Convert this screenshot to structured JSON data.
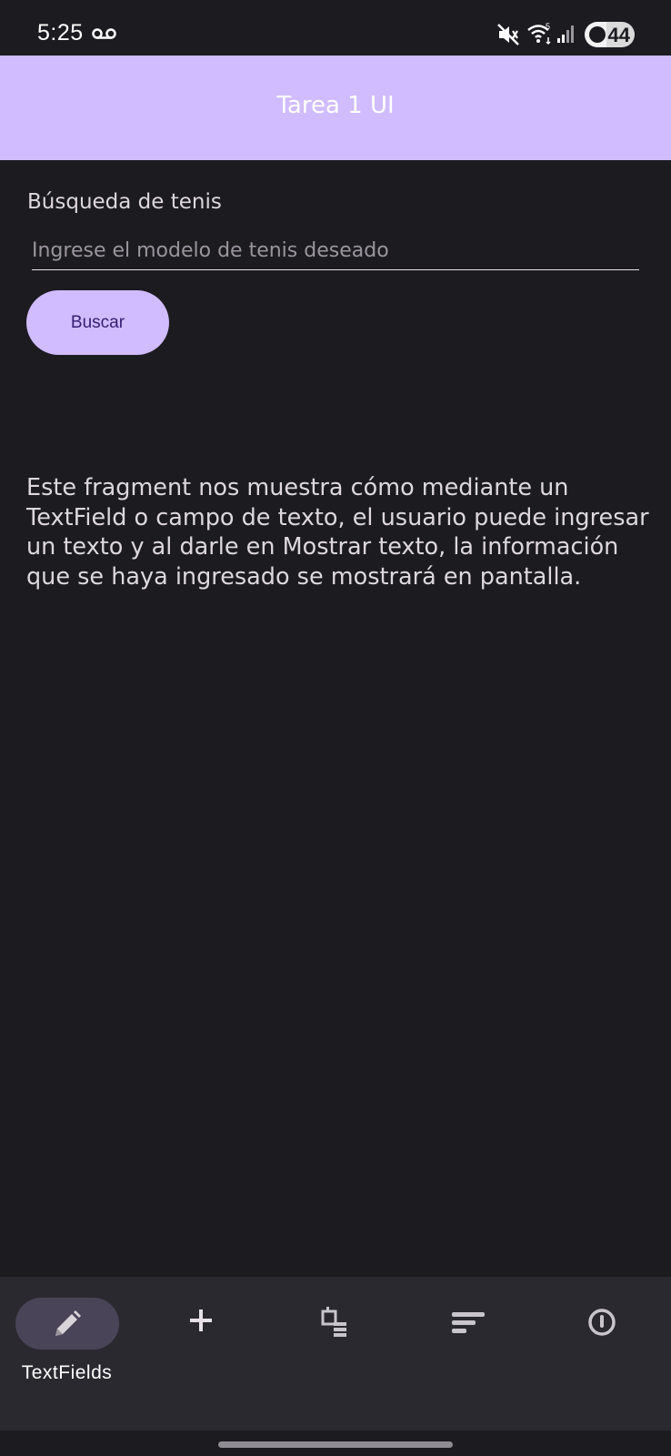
{
  "status_bar": {
    "time": "5:25",
    "battery_level": "44",
    "icons": [
      "voicemail-icon",
      "mute-icon",
      "wifi-icon",
      "signal-icon",
      "battery-icon"
    ]
  },
  "app_bar": {
    "title": "Tarea 1 UI",
    "color": "#d0bcff"
  },
  "form": {
    "section_label": "Búsqueda de tenis",
    "search_input": {
      "placeholder": "Ingrese el modelo de tenis deseado",
      "value": ""
    },
    "search_button_label": "Buscar"
  },
  "description": "Este fragment nos muestra cómo mediante un TextField o campo de texto, el usuario puede ingresar un texto y al darle en Mostrar texto, la información que se haya ingresado se mostrará en pantalla.",
  "bottom_nav": {
    "items": [
      {
        "icon": "pencil-icon",
        "label": "TextFields",
        "selected": true
      },
      {
        "icon": "plus-icon",
        "label": "",
        "selected": false
      },
      {
        "icon": "list-check-icon",
        "label": "",
        "selected": false
      },
      {
        "icon": "sort-icon",
        "label": "",
        "selected": false
      },
      {
        "icon": "power-icon",
        "label": "",
        "selected": false
      }
    ]
  },
  "colors": {
    "background": "#1c1b20",
    "accent": "#d0bcff",
    "nav_background": "#2b2930",
    "nav_indicator": "#4a4458"
  }
}
